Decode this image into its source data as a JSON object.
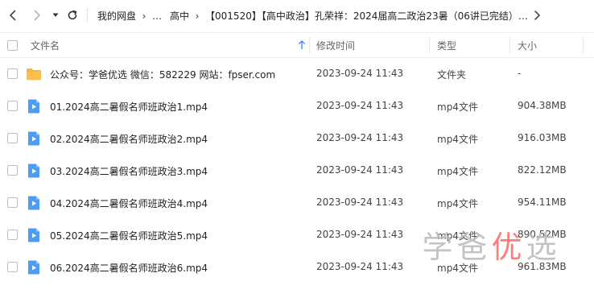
{
  "breadcrumb": {
    "items": [
      "我的网盘",
      "…",
      "高中",
      "【001520】【高中政治】孔荣祥：2024届高二政治23暑（06讲已完结）…"
    ]
  },
  "columns": {
    "name": "文件名",
    "mtime": "修改时间",
    "type": "类型",
    "size": "大小"
  },
  "rows": [
    {
      "icon": "folder-icon",
      "name": "公众号：学爸优选 微信：582229 网站：fpser.com",
      "mtime": "2023-09-24 11:43",
      "type": "文件夹",
      "size": "-"
    },
    {
      "icon": "video-file-icon",
      "name": "01.2024高二暑假名师班政治1.mp4",
      "mtime": "2023-09-24 11:43",
      "type": "mp4文件",
      "size": "904.38MB"
    },
    {
      "icon": "video-file-icon",
      "name": "02.2024高二暑假名师班政治2.mp4",
      "mtime": "2023-09-24 11:43",
      "type": "mp4文件",
      "size": "916.03MB"
    },
    {
      "icon": "video-file-icon",
      "name": "03.2024高二暑假名师班政治3.mp4",
      "mtime": "2023-09-24 11:43",
      "type": "mp4文件",
      "size": "822.12MB"
    },
    {
      "icon": "video-file-icon",
      "name": "04.2024高二暑假名师班政治4.mp4",
      "mtime": "2023-09-24 11:43",
      "type": "mp4文件",
      "size": "954.11MB"
    },
    {
      "icon": "video-file-icon",
      "name": "05.2024高二暑假名师班政治5.mp4",
      "mtime": "2023-09-24 11:43",
      "type": "mp4文件",
      "size": "890.52MB"
    },
    {
      "icon": "video-file-icon",
      "name": "06.2024高二暑假名师班政治6.mp4",
      "mtime": "2023-09-24 11:43",
      "type": "mp4文件",
      "size": "961.83MB"
    }
  ],
  "watermark": [
    "学",
    "爸",
    "优",
    "选"
  ],
  "colors": {
    "folder": "#f5b53f",
    "video": "#4a9ff5",
    "sort_arrow": "#3a8ef6",
    "watermark_gray": "#bdbdbd",
    "watermark_red": "#ff6f6f"
  }
}
